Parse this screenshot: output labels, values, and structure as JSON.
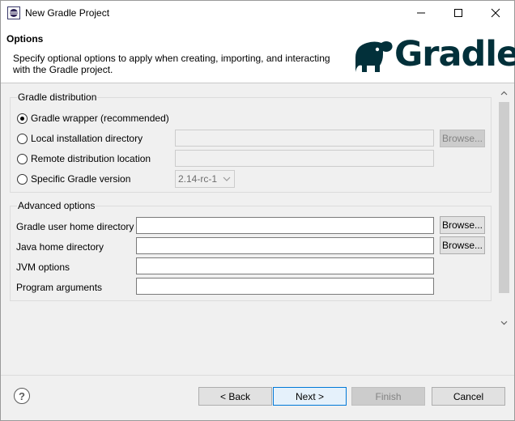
{
  "window": {
    "title": "New Gradle Project",
    "minimize_icon": "minimize-icon",
    "maximize_icon": "maximize-icon",
    "close_icon": "close-icon"
  },
  "banner": {
    "title": "Options",
    "description": "Specify optional options to apply when creating, importing, and interacting with the Gradle project.",
    "logo_text": "Gradle"
  },
  "distribution": {
    "legend": "Gradle distribution",
    "wrapper_label": "Gradle wrapper (recommended)",
    "local_label": "Local installation directory",
    "remote_label": "Remote distribution location",
    "version_label": "Specific Gradle version",
    "local_value": "",
    "remote_value": "",
    "browse_label": "Browse...",
    "version_value": "2.14-rc-1",
    "selected": "Gradle wrapper (recommended)"
  },
  "advanced": {
    "legend": "Advanced options",
    "user_home_label": "Gradle user home directory",
    "java_home_label": "Java home directory",
    "jvm_label": "JVM options",
    "args_label": "Program arguments",
    "user_home_value": "",
    "java_home_value": "",
    "jvm_value": "",
    "args_value": "",
    "browse_label": "Browse..."
  },
  "footer": {
    "help_icon": "help-icon",
    "help_glyph": "?",
    "back_label": "< Back",
    "next_label": "Next >",
    "finish_label": "Finish",
    "cancel_label": "Cancel"
  },
  "colors": {
    "gradle_brand": "#02303a",
    "primary_button_border": "#0078d7"
  }
}
